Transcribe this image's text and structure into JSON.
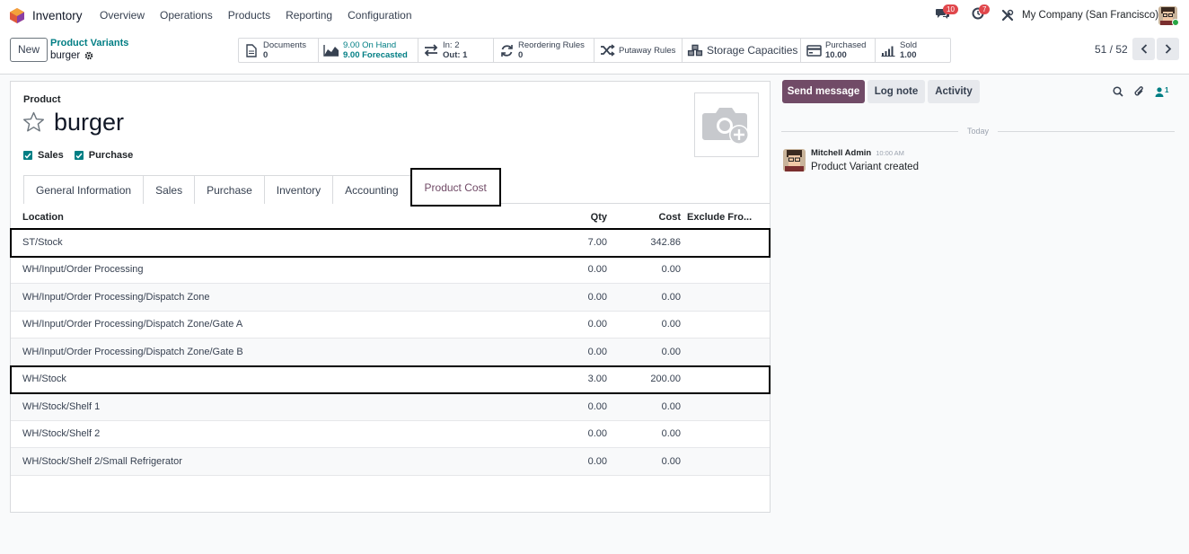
{
  "navbar": {
    "app_name": "Inventory",
    "menu": [
      "Overview",
      "Operations",
      "Products",
      "Reporting",
      "Configuration"
    ],
    "messages_badge": "10",
    "activity_badge": "7",
    "company": "My Company (San Francisco)"
  },
  "control_panel": {
    "new_label": "New",
    "breadcrumb": "Product Variants",
    "record_name": "burger",
    "pager": "51 / 52"
  },
  "smart_buttons": {
    "documents": {
      "l1": "Documents",
      "l2": "0"
    },
    "on_hand": {
      "l1": "9.00 On Hand",
      "l2": "9.00 Forecasted"
    },
    "in_out": {
      "l1": "In: 2",
      "l2": "Out: 1"
    },
    "reordering": {
      "l1": "Reordering Rules",
      "l2": "0"
    },
    "putaway": {
      "l1": "Putaway Rules"
    },
    "storage": {
      "l1": "Storage Capacities"
    },
    "purchased": {
      "l1": "Purchased",
      "l2": "10.00"
    },
    "sold": {
      "l1": "Sold",
      "l2": "1.00"
    }
  },
  "form": {
    "product_label": "Product",
    "product_name": "burger",
    "sales_label": "Sales",
    "purchase_label": "Purchase",
    "tabs": [
      "General Information",
      "Sales",
      "Purchase",
      "Inventory",
      "Accounting",
      "Product Cost"
    ],
    "active_tab": "Product Cost"
  },
  "cost_table": {
    "headers": {
      "location": "Location",
      "qty": "Qty",
      "cost": "Cost",
      "exclude": "Exclude Fro..."
    },
    "rows": [
      {
        "location": "ST/Stock",
        "qty": "7.00",
        "cost": "342.86",
        "highlight": true
      },
      {
        "location": "WH/Input/Order Processing",
        "qty": "0.00",
        "cost": "0.00",
        "highlight": false
      },
      {
        "location": "WH/Input/Order Processing/Dispatch Zone",
        "qty": "0.00",
        "cost": "0.00",
        "highlight": false
      },
      {
        "location": "WH/Input/Order Processing/Dispatch Zone/Gate A",
        "qty": "0.00",
        "cost": "0.00",
        "highlight": false
      },
      {
        "location": "WH/Input/Order Processing/Dispatch Zone/Gate B",
        "qty": "0.00",
        "cost": "0.00",
        "highlight": false
      },
      {
        "location": "WH/Stock",
        "qty": "3.00",
        "cost": "200.00",
        "highlight": true
      },
      {
        "location": "WH/Stock/Shelf 1",
        "qty": "0.00",
        "cost": "0.00",
        "highlight": false
      },
      {
        "location": "WH/Stock/Shelf 2",
        "qty": "0.00",
        "cost": "0.00",
        "highlight": false
      },
      {
        "location": "WH/Stock/Shelf 2/Small Refrigerator",
        "qty": "0.00",
        "cost": "0.00",
        "highlight": false
      }
    ]
  },
  "chatter": {
    "send_message": "Send message",
    "log_note": "Log note",
    "activity": "Activity",
    "followers_count": "1",
    "date_separator": "Today",
    "message": {
      "author": "Mitchell Admin",
      "time": "10:00 AM",
      "body": "Product Variant created"
    }
  },
  "colors": {
    "brand": "#714b67",
    "accent": "#017e84",
    "badge": "#e0474c"
  }
}
